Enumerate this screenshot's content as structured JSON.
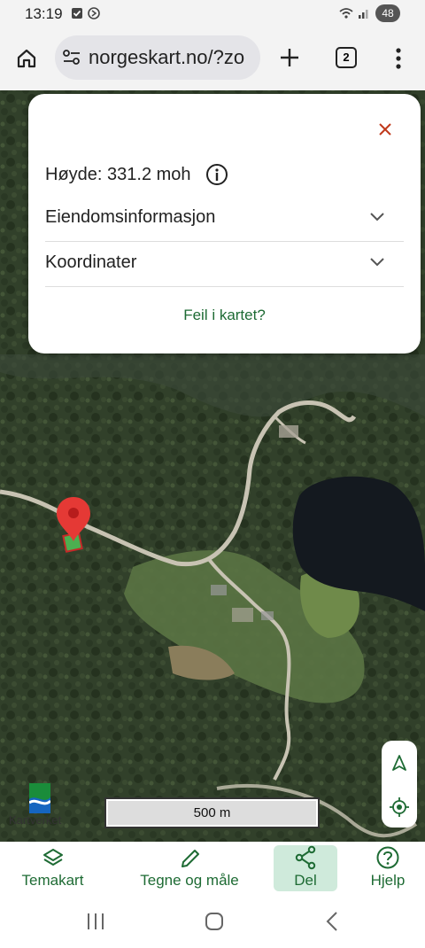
{
  "status": {
    "time": "13:19",
    "battery": "48"
  },
  "browser": {
    "url": "norgeskart.no/?zo",
    "tab_count": "2"
  },
  "popup": {
    "height_label": "Høyde: 331.2 moh",
    "rows": [
      {
        "label": "Eiendomsinformasjon"
      },
      {
        "label": "Koordinater"
      }
    ],
    "report_link": "Feil i kartet?"
  },
  "map": {
    "logo_text": "Kartverket",
    "scale_label": "500 m"
  },
  "nav": {
    "items": [
      {
        "label": "Temakart",
        "icon": "layers-icon"
      },
      {
        "label": "Tegne og måle",
        "icon": "pencil-icon"
      },
      {
        "label": "Del",
        "icon": "share-icon",
        "active": true
      },
      {
        "label": "Hjelp",
        "icon": "help-icon"
      }
    ]
  },
  "colors": {
    "accent": "#1e6b34",
    "active_bg": "#cfeadb",
    "marker": "#e53935"
  }
}
